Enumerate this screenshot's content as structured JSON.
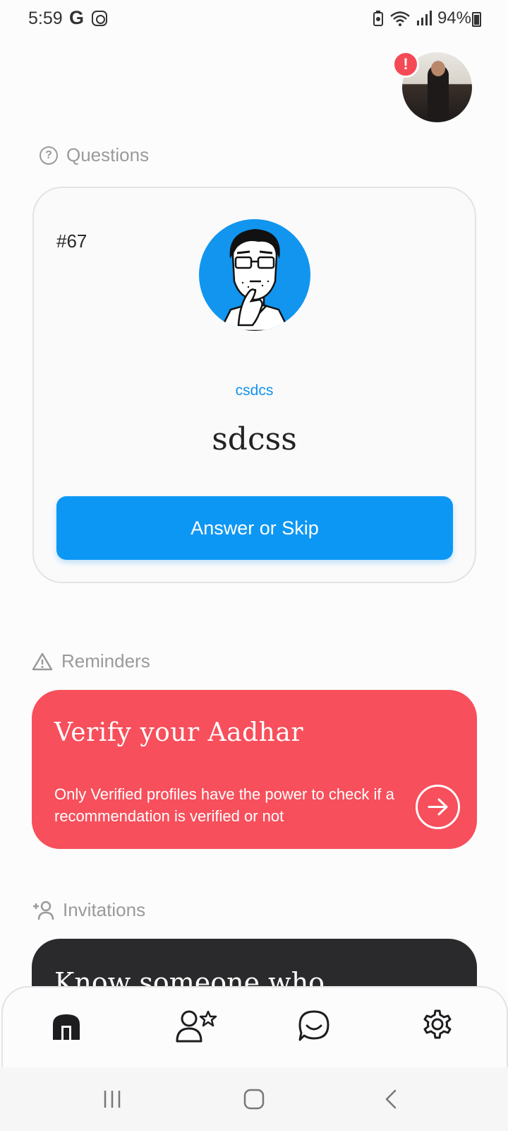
{
  "status_bar": {
    "time": "5:59",
    "battery": "94%"
  },
  "profile": {
    "alert_badge": "!"
  },
  "questions": {
    "header": "Questions",
    "card": {
      "number": "#67",
      "author": "csdcs",
      "question": "sdcss",
      "button_label": "Answer or Skip"
    }
  },
  "reminders": {
    "header": "Reminders",
    "card": {
      "title": "Verify your Aadhar",
      "description": "Only Verified profiles have the power to check if a recommendation is verified or not"
    }
  },
  "invitations": {
    "header": "Invitations",
    "card": {
      "title": "Know someone who"
    }
  },
  "bottom_nav": {
    "items": [
      {
        "name": "home",
        "icon": "home-icon",
        "active": true
      },
      {
        "name": "recommendations",
        "icon": "user-star-icon",
        "active": false
      },
      {
        "name": "chat",
        "icon": "chat-icon",
        "active": false
      },
      {
        "name": "settings",
        "icon": "gear-icon",
        "active": false
      }
    ]
  },
  "colors": {
    "primary_blue": "#0d97f5",
    "reminder_red": "#f74f5b",
    "invitation_dark": "#2a2a2c",
    "muted_text": "#9a9a9c"
  }
}
